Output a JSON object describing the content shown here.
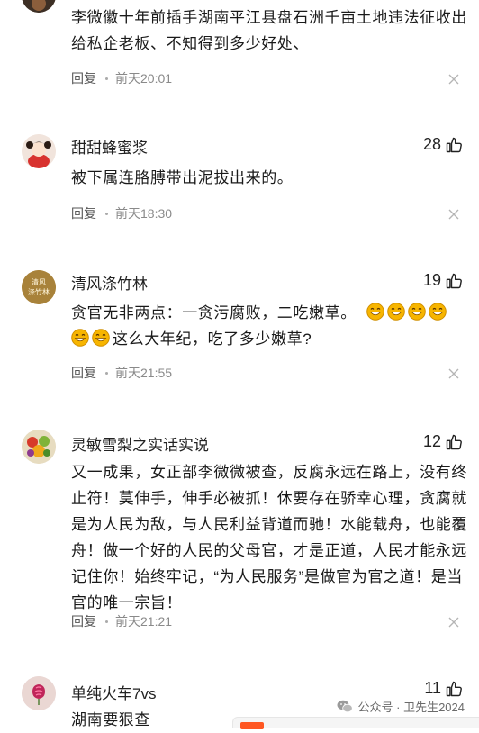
{
  "comments": [
    {
      "name": "",
      "likes": "",
      "text": "李微徽十年前插手湖南平江县盘石洲千亩土地违法征收出给私企老板、不知得到多少好处、",
      "reply": "回复",
      "time": "前天20:01"
    },
    {
      "name": "甜甜蜂蜜浆",
      "likes": "28",
      "text": "被下属连胳膊带出泥拔出来的。",
      "reply": "回复",
      "time": "前天18:30"
    },
    {
      "name": "清风涤竹林",
      "likes": "19",
      "text_a": "贪官无非两点：一贪污腐败，二吃嫩草。",
      "text_b": "这么大年纪，吃了多少嫩草?",
      "reply": "回复",
      "time": "前天21:55",
      "avatar_text": "清风 涤竹林"
    },
    {
      "name": "灵敏雪梨之实话实说",
      "likes": "12",
      "text": "又一成果，女正部李微微被查，反腐永远在路上，没有终止符！莫伸手，伸手必被抓！休要存在骄幸心理，贪腐就是为人民为敌，与人民利益背道而驰！水能载舟，也能覆舟！做一个好的人民的父母官，才是正道，人民才能永远记住你！始终牢记，“为人民服务”是做官为官之道！是当官的唯一宗旨！",
      "reply": "回复",
      "time": "前天21:21"
    },
    {
      "name": "单纯火车7vs",
      "likes": "11",
      "text": "湖南要狠查"
    }
  ],
  "watermark": "公众号 · 卫先生2024",
  "colors": {
    "emoji": "#f7b500",
    "dark": "#222222",
    "muted": "#8a8a8a"
  },
  "icons": [
    "thumbs-up-icon",
    "close-icon",
    "grin-emoji-icon",
    "wechat-icon"
  ]
}
